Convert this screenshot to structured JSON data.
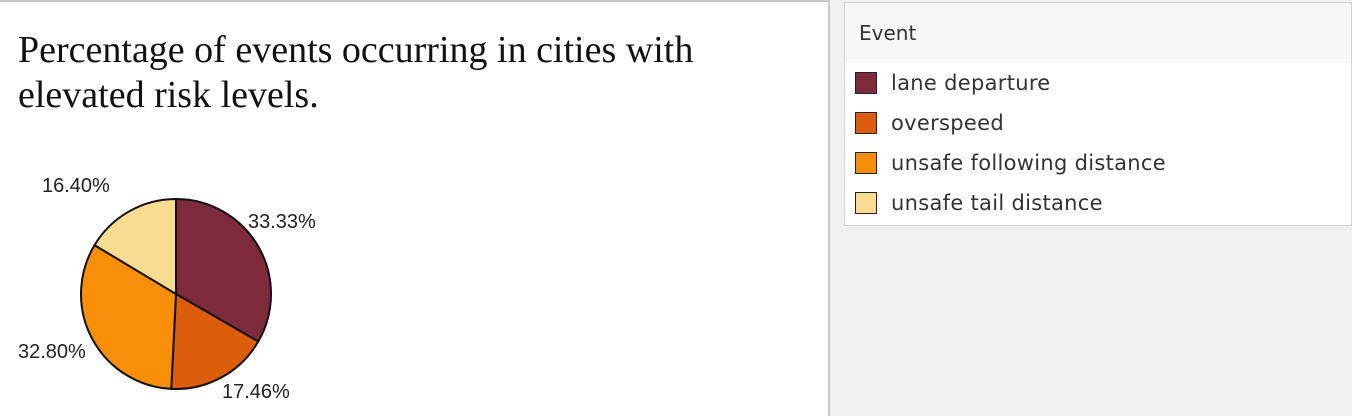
{
  "chart_data": {
    "type": "pie",
    "title": "Percentage of events occurring in cities with elevated risk levels.",
    "legend_title": "Event",
    "legend_placement": "right",
    "slices": [
      {
        "name": "lane departure",
        "value": 33.33,
        "label": "33.33%",
        "color": "#7e2a3d"
      },
      {
        "name": "overspeed",
        "value": 17.46,
        "label": "17.46%",
        "color": "#dc5e0c"
      },
      {
        "name": "unsafe following distance",
        "value": 32.8,
        "label": "32.80%",
        "color": "#f98e09"
      },
      {
        "name": "unsafe tail distance",
        "value": 16.4,
        "label": "16.40%",
        "color": "#f8dc92"
      }
    ]
  }
}
